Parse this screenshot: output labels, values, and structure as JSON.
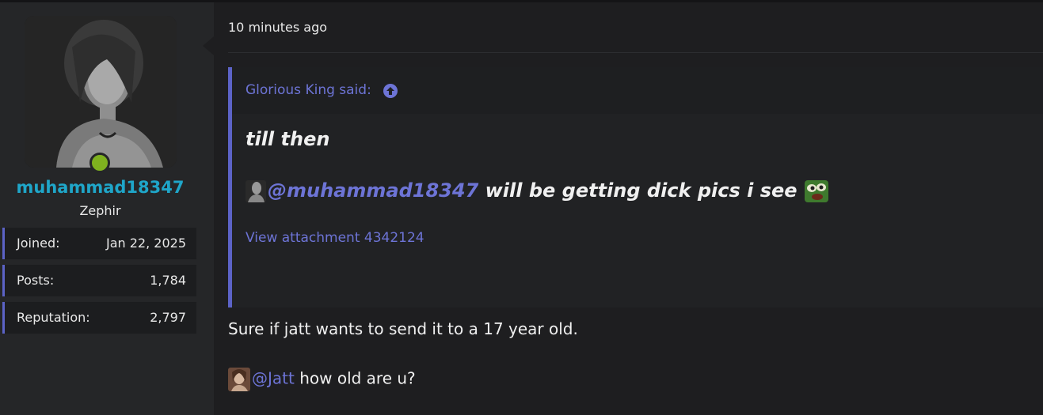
{
  "user": {
    "username": "muhammad18347",
    "title": "Zephir",
    "online_color": "#7fb21f",
    "stats": [
      {
        "label": "Joined:",
        "value": "Jan 22, 2025"
      },
      {
        "label": "Posts:",
        "value": "1,784"
      },
      {
        "label": "Reputation:",
        "value": "2,797"
      }
    ]
  },
  "post": {
    "timestamp": "10 minutes ago",
    "quote": {
      "author_said": "Glorious King said:",
      "line1": "till then",
      "mention": "@muhammad18347",
      "line2_rest": " will be getting dick pics i see",
      "attachment_link": "View attachment 4342124"
    },
    "body_line1": "Sure if jatt wants to send it to a 17 year old.",
    "body_mention": "@Jatt",
    "body_line2_rest": " how old are u?"
  },
  "colors": {
    "accent": "#5c63c7",
    "link": "#6d74d6",
    "username": "#1fa6c9"
  }
}
